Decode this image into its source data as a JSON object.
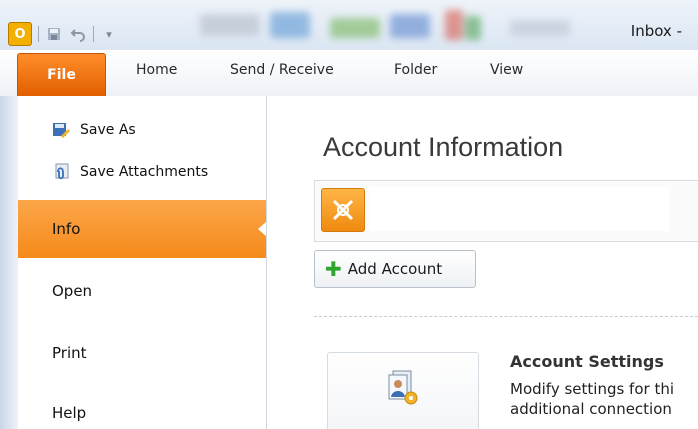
{
  "window": {
    "title": "Inbox -"
  },
  "ribbon": {
    "tabs": [
      "File",
      "Home",
      "Send / Receive",
      "Folder",
      "View"
    ]
  },
  "backstage": {
    "commands": [
      "Save As",
      "Save Attachments"
    ],
    "nav": [
      "Info",
      "Open",
      "Print",
      "Help"
    ],
    "selected": "Info"
  },
  "main": {
    "heading": "Account Information",
    "add_account": "Add Account",
    "account_settings_title": "Account Settings",
    "account_settings_desc_1": "Modify settings for thi",
    "account_settings_desc_2": "additional connection"
  },
  "colors": {
    "file_tab": "#e8690f",
    "selected_nav": "#f8961e",
    "add_icon": "#2fa52f"
  },
  "icons": {
    "app": "outlook-icon",
    "save_as": "save-as-icon",
    "attachments": "attachments-icon",
    "exchange": "exchange-icon",
    "add": "plus-icon",
    "account_settings": "account-settings-icon"
  }
}
